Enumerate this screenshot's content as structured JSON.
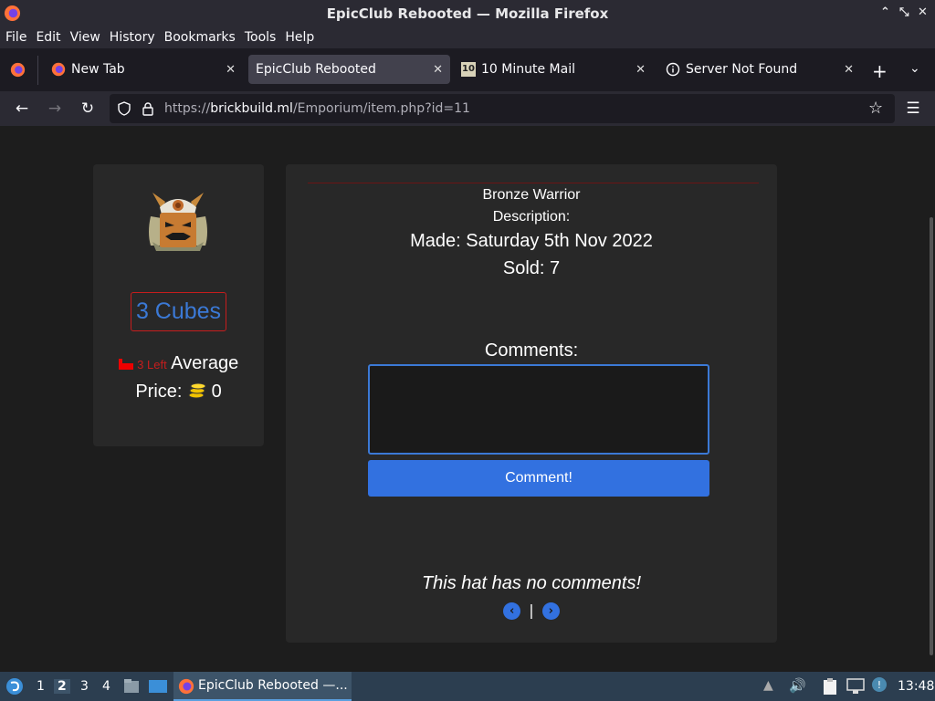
{
  "window": {
    "title": "EpicClub Rebooted — Mozilla Firefox"
  },
  "menu": [
    "File",
    "Edit",
    "View",
    "History",
    "Bookmarks",
    "Tools",
    "Help"
  ],
  "tabs": [
    {
      "label": "New Tab",
      "icon": "firefox-icon"
    },
    {
      "label": "EpicClub Rebooted",
      "icon": "none",
      "active": true
    },
    {
      "label": "10 Minute Mail",
      "icon": "ten-minute-mail-icon",
      "icon_text": "10"
    },
    {
      "label": "Server Not Found",
      "icon": "info-icon"
    }
  ],
  "url": {
    "prefix": "https://",
    "domain": "brickbuild.ml",
    "path": "/Emporium/item.php?id=11"
  },
  "item": {
    "price": "3 Cubes",
    "stock": "3 Left",
    "rarity": "Average",
    "price_label": "Price:",
    "price_coins": "0",
    "name": "Bronze Warrior",
    "description_label": "Description:",
    "made": "Made: Saturday 5th Nov 2022",
    "sold": "Sold: 7",
    "comments_label": "Comments:",
    "comment_button": "Comment!",
    "no_comments": "This hat has no comments!",
    "pager_sep": "|"
  },
  "taskbar": {
    "workspaces": [
      "1",
      "2",
      "3",
      "4"
    ],
    "window_label": "EpicClub Rebooted —...",
    "clock": "13:48"
  },
  "colors": {
    "accent": "#3271e0",
    "red": "#c61d1d",
    "bg": "#1d1d1d",
    "card": "#282828"
  }
}
